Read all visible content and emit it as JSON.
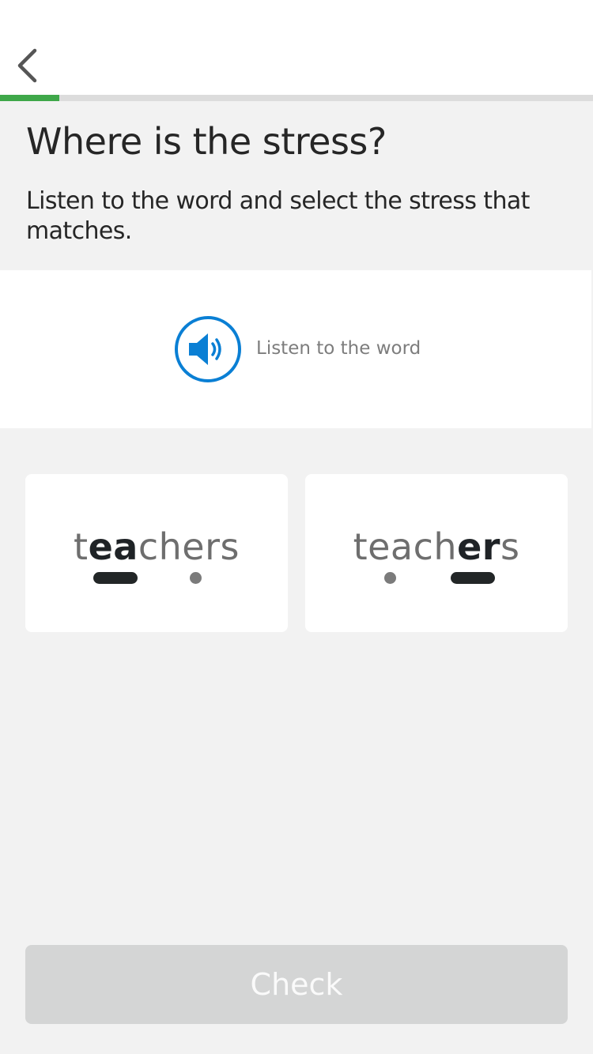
{
  "header": {
    "back_icon": "chevron-left-icon"
  },
  "progress": {
    "fraction": 0.1,
    "color": "#3fa84a"
  },
  "exercise": {
    "title": "Where is the stress?",
    "instruction": "Listen to the word and select the stress that matches."
  },
  "audio": {
    "icon": "speaker-icon",
    "label": "Listen to the word",
    "accent_color": "#0a7fd4"
  },
  "options": [
    {
      "parts": [
        "t",
        "ea",
        "chers"
      ],
      "stressed_index": 1,
      "pattern": [
        "stressed",
        "unstressed"
      ]
    },
    {
      "parts": [
        "teach",
        "er",
        "s"
      ],
      "stressed_index": 1,
      "pattern": [
        "unstressed",
        "stressed"
      ]
    }
  ],
  "footer": {
    "check_label": "Check",
    "check_enabled": false
  }
}
